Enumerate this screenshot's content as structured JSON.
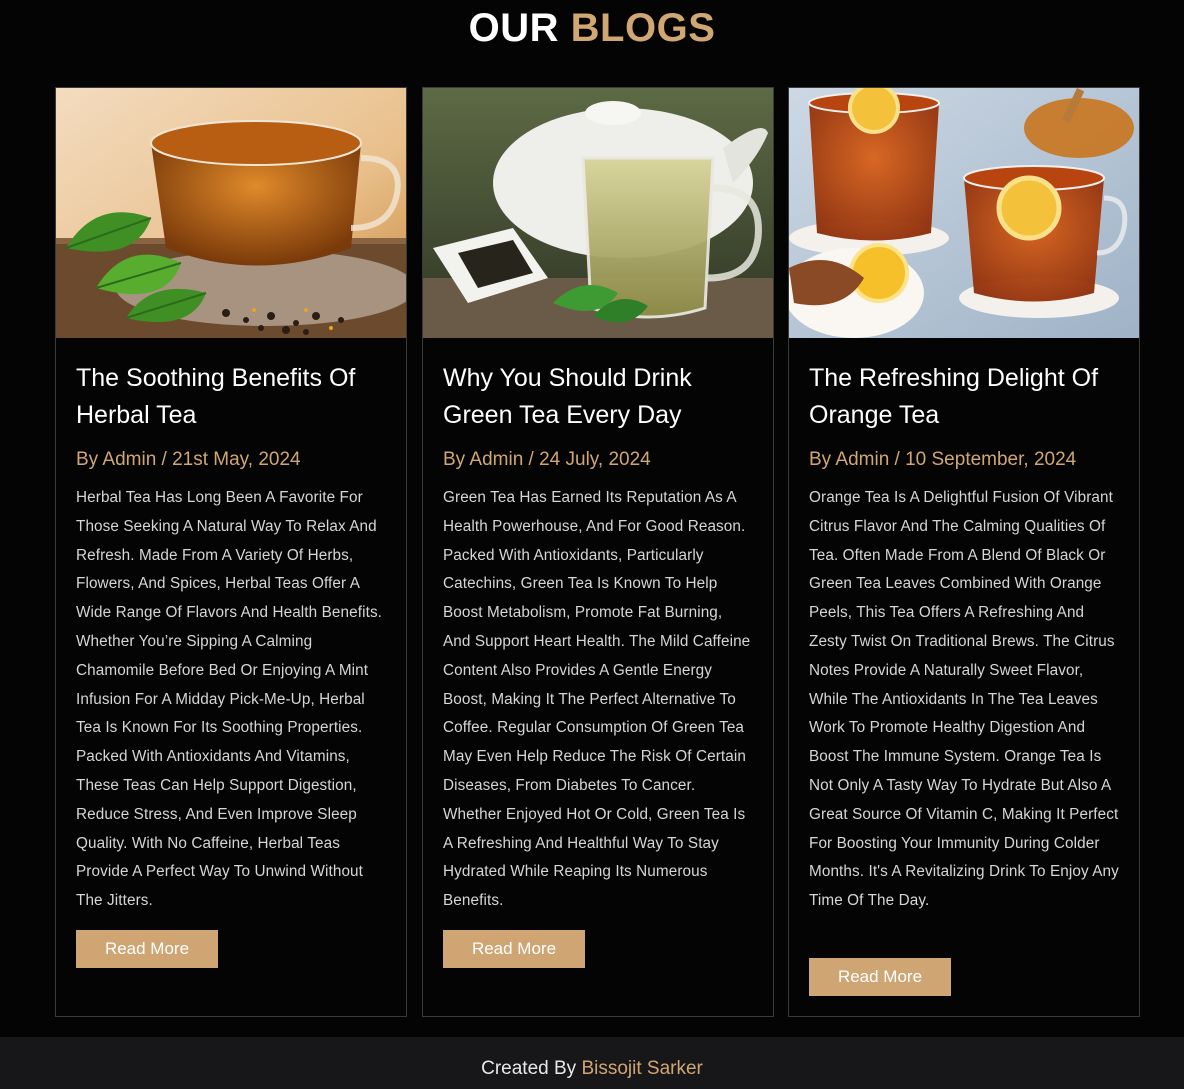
{
  "heading": {
    "word1": "OUR",
    "word2": "BLOGS"
  },
  "posts": [
    {
      "title": "The Soothing Benefits Of Herbal Tea",
      "meta": "By Admin / 21st May, 2024",
      "body": "Herbal Tea Has Long Been A Favorite For Those Seeking A Natural Way To Relax And Refresh. Made From A Variety Of Herbs, Flowers, And Spices, Herbal Teas Offer A Wide Range Of Flavors And Health Benefits. Whether You’re Sipping A Calming Chamomile Before Bed Or Enjoying A Mint Infusion For A Midday Pick-Me-Up, Herbal Tea Is Known For Its Soothing Properties. Packed With Antioxidants And Vitamins, These Teas Can Help Support Digestion, Reduce Stress, And Even Improve Sleep Quality. With No Caffeine, Herbal Teas Provide A Perfect Way To Unwind Without The Jitters.",
      "button": "Read More"
    },
    {
      "title": "Why You Should Drink Green Tea Every Day",
      "meta": "By Admin / 24 July, 2024",
      "body": "Green Tea Has Earned Its Reputation As A Health Powerhouse, And For Good Reason. Packed With Antioxidants, Particularly Catechins, Green Tea Is Known To Help Boost Metabolism, Promote Fat Burning, And Support Heart Health. The Mild Caffeine Content Also Provides A Gentle Energy Boost, Making It The Perfect Alternative To Coffee. Regular Consumption Of Green Tea May Even Help Reduce The Risk Of Certain Diseases, From Diabetes To Cancer. Whether Enjoyed Hot Or Cold, Green Tea Is A Refreshing And Healthful Way To Stay Hydrated While Reaping Its Numerous Benefits.",
      "button": "Read More"
    },
    {
      "title": "The Refreshing Delight Of Orange Tea",
      "meta": "By Admin / 10 September, 2024",
      "body": "Orange Tea Is A Delightful Fusion Of Vibrant Citrus Flavor And The Calming Qualities Of Tea. Often Made From A Blend Of Black Or Green Tea Leaves Combined With Orange Peels, This Tea Offers A Refreshing And Zesty Twist On Traditional Brews. The Citrus Notes Provide A Naturally Sweet Flavor, While The Antioxidants In The Tea Leaves Work To Promote Healthy Digestion And Boost The Immune System. Orange Tea Is Not Only A Tasty Way To Hydrate But Also A Great Source Of Vitamin C, Making It Perfect For Boosting Your Immunity During Colder Months. It's A Revitalizing Drink To Enjoy Any Time Of The Day.",
      "button": "Read More"
    }
  ],
  "footer": {
    "prefix": "Created By",
    "name": "Bissojit Sarker"
  }
}
